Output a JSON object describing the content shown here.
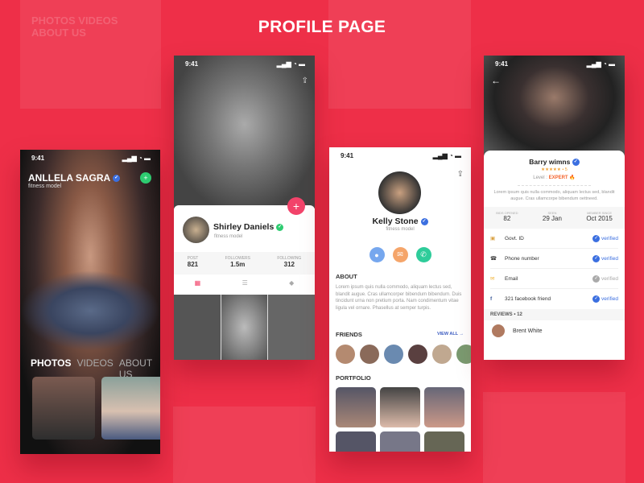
{
  "page_title": "PROFILE PAGE",
  "colors": {
    "background": "#ee2f48",
    "accent_pink": "#f2436a",
    "verified_blue": "#3b6fe0",
    "green": "#2ecc71",
    "expert_orange": "#f4632c"
  },
  "ghost": {
    "tabs": "PHOTOS   VIDEOS   ABOUT US"
  },
  "screen1": {
    "time": "9:41",
    "name": "ANLLELA SAGRA",
    "subtitle": "fitness model",
    "tabs": [
      "PHOTOS",
      "VIDEOS",
      "ABOUT US"
    ],
    "add_icon": "plus-icon"
  },
  "screen2": {
    "time": "9:41",
    "name": "Shirley Daniels",
    "subtitle": "fitness model",
    "stats": [
      {
        "label": "POST",
        "value": "821"
      },
      {
        "label": "FOLLOWERS",
        "value": "1.5m"
      },
      {
        "label": "FOLLOWING",
        "value": "312"
      }
    ],
    "tab_icons": [
      "grid-icon",
      "list-icon",
      "tag-icon"
    ]
  },
  "screen3": {
    "time": "9:41",
    "name": "Kelly Stone",
    "subtitle": "fitness model",
    "about_title": "ABOUT",
    "about_text": "Lorem ipsum quis nulla commodo, aliquam lectus sed, blandit augue. Cras ullamcorper bibendum bibendum. Duis tincidunt urna non pretium porta. Nam condimentum vitae ligula vel ornare. Phasellus at semper turpis.",
    "friends_title": "FRIENDS",
    "view_all": "VIEW ALL",
    "portfolio_title": "PORTFOLIO",
    "actions": [
      "user-icon",
      "mail-icon",
      "phone-icon"
    ]
  },
  "screen4": {
    "time": "9:41",
    "name": "Barry wimns",
    "rating": "5",
    "level_label": "Level :",
    "level_value": "EXPERT",
    "quote": "Lorem ipsum quis nulla commodo, aliquam lectus sed, blandit augue. Cras ullamcorpe bibendum oettneed.",
    "stats": [
      {
        "label": "BIDS OPENED",
        "value": "82"
      },
      {
        "label": "SEEN",
        "value": "29 Jan"
      },
      {
        "label": "MEMBER SINCE",
        "value": "Oct 2015"
      }
    ],
    "verifications": [
      {
        "label": "Govt. ID",
        "status": "verified",
        "active": true
      },
      {
        "label": "Phone number",
        "status": "verified",
        "active": true
      },
      {
        "label": "Email",
        "status": "verified",
        "active": false
      },
      {
        "label": "321 facebook friend",
        "status": "verified",
        "active": true
      }
    ],
    "reviews_title": "REVIEWS • 12",
    "reviewer": "Brent White"
  }
}
